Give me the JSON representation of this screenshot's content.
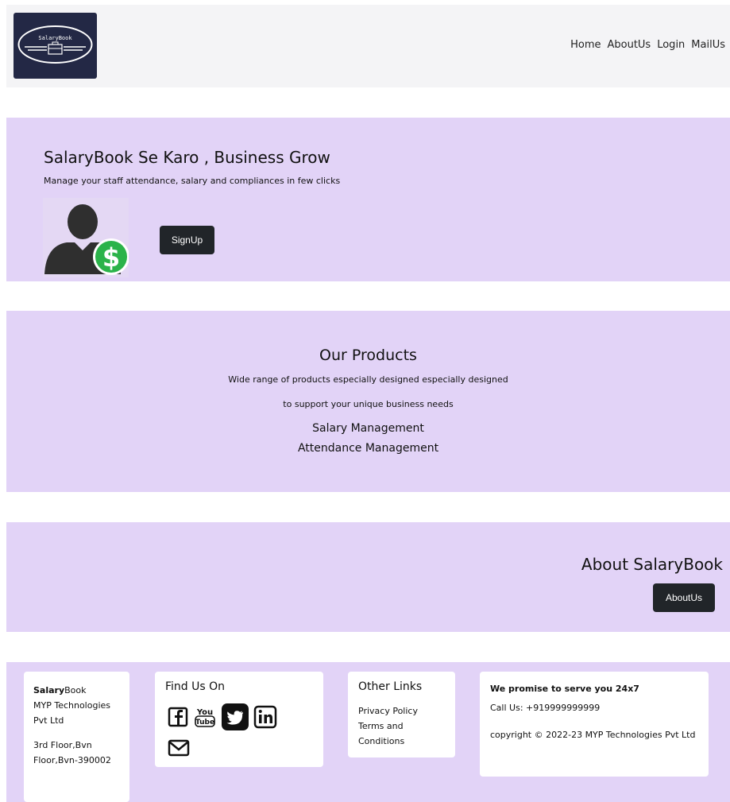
{
  "brand": {
    "logo_text": "SalaryBook"
  },
  "nav": {
    "items": [
      {
        "label": "Home"
      },
      {
        "label": "AboutUs"
      },
      {
        "label": "Login"
      },
      {
        "label": "MailUs"
      }
    ]
  },
  "hero": {
    "title": "SalaryBook Se Karo , Business Grow",
    "subtitle": "Manage your staff attendance, salary and compliances in few clicks",
    "signup_label": "SignUp"
  },
  "products": {
    "title": "Our Products",
    "line1": "Wide range of products especially designed especially designed",
    "line2": "to support your unique business needs",
    "items": [
      "Salary Management",
      "Attendance Management"
    ]
  },
  "about": {
    "title": "About SalaryBook",
    "button_label": "AboutUs"
  },
  "footer": {
    "brand_bold": "Salary",
    "brand_rest": "Book",
    "company": "MYP Technologies Pvt Ltd",
    "address": "3rd Floor,Bvn Floor,Bvn-390002",
    "find_us_title": "Find Us On",
    "social_icons": [
      "facebook-icon",
      "youtube-icon",
      "twitter-icon",
      "linkedin-icon",
      "mail-icon"
    ],
    "other_links_title": "Other Links",
    "links": [
      "Privacy Policy",
      "Terms and Conditions"
    ],
    "promise": "We promise to serve you 24x7",
    "call": "Call Us: +919999999999",
    "copyright": "copyright © 2022-23 MYP Technologies Pvt Ltd"
  },
  "colors": {
    "band": "#e2d3f7",
    "navbar": "#f4f4f6",
    "logo_bg": "#232845",
    "button": "#212529",
    "dollar_green": "#2bb34a"
  }
}
